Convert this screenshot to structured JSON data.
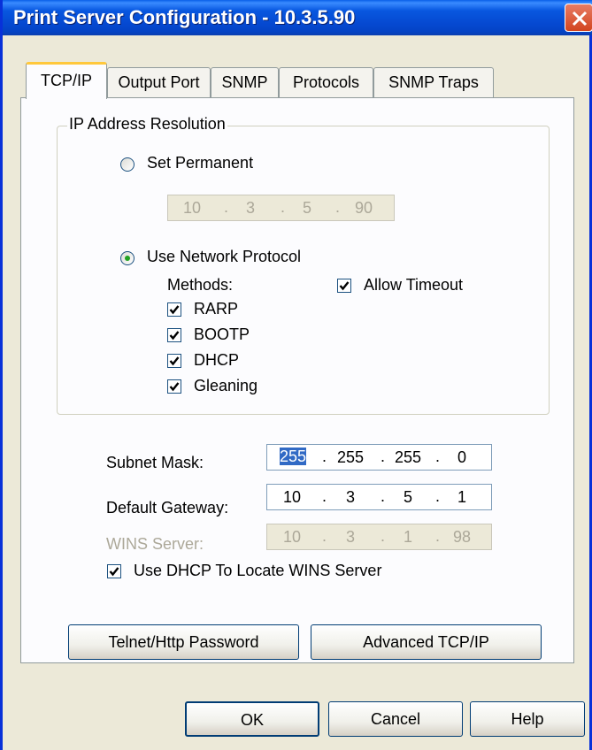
{
  "window": {
    "title": "Print Server Configuration - 10.3.5.90"
  },
  "tabs": [
    {
      "label": "TCP/IP",
      "active": true
    },
    {
      "label": "Output Port"
    },
    {
      "label": "SNMP"
    },
    {
      "label": "Protocols"
    },
    {
      "label": "SNMP Traps"
    }
  ],
  "ip_resolution": {
    "group_label": "IP Address Resolution",
    "set_permanent": {
      "label": "Set Permanent",
      "selected": false,
      "address": [
        "10",
        "3",
        "5",
        "90"
      ]
    },
    "use_network": {
      "label": "Use Network Protocol",
      "selected": true
    },
    "methods_label": "Methods:",
    "methods": [
      {
        "label": "RARP",
        "checked": true
      },
      {
        "label": "BOOTP",
        "checked": true
      },
      {
        "label": "DHCP",
        "checked": true
      },
      {
        "label": "Gleaning",
        "checked": true
      }
    ],
    "allow_timeout": {
      "label": "Allow Timeout",
      "checked": true
    }
  },
  "network": {
    "subnet_mask": {
      "label": "Subnet Mask:",
      "octets": [
        "255",
        "255",
        "255",
        "0"
      ]
    },
    "default_gateway": {
      "label": "Default Gateway:",
      "octets": [
        "10",
        "3",
        "5",
        "1"
      ]
    },
    "wins_server": {
      "label": "WINS Server:",
      "octets": [
        "10",
        "3",
        "1",
        "98"
      ],
      "disabled": true
    },
    "use_dhcp_wins": {
      "label": "Use DHCP To Locate WINS Server",
      "checked": true
    }
  },
  "buttons": {
    "telnet_password": "Telnet/Http Password",
    "advanced_tcpip": "Advanced TCP/IP",
    "ok": "OK",
    "cancel": "Cancel",
    "help": "Help"
  },
  "colors": {
    "title_bar": "#0548d0",
    "dialog_bg": "#ece9d8",
    "active_tab_accent": "#ffc83c",
    "selection": "#316ac5",
    "radio_dot": "#21a121"
  }
}
